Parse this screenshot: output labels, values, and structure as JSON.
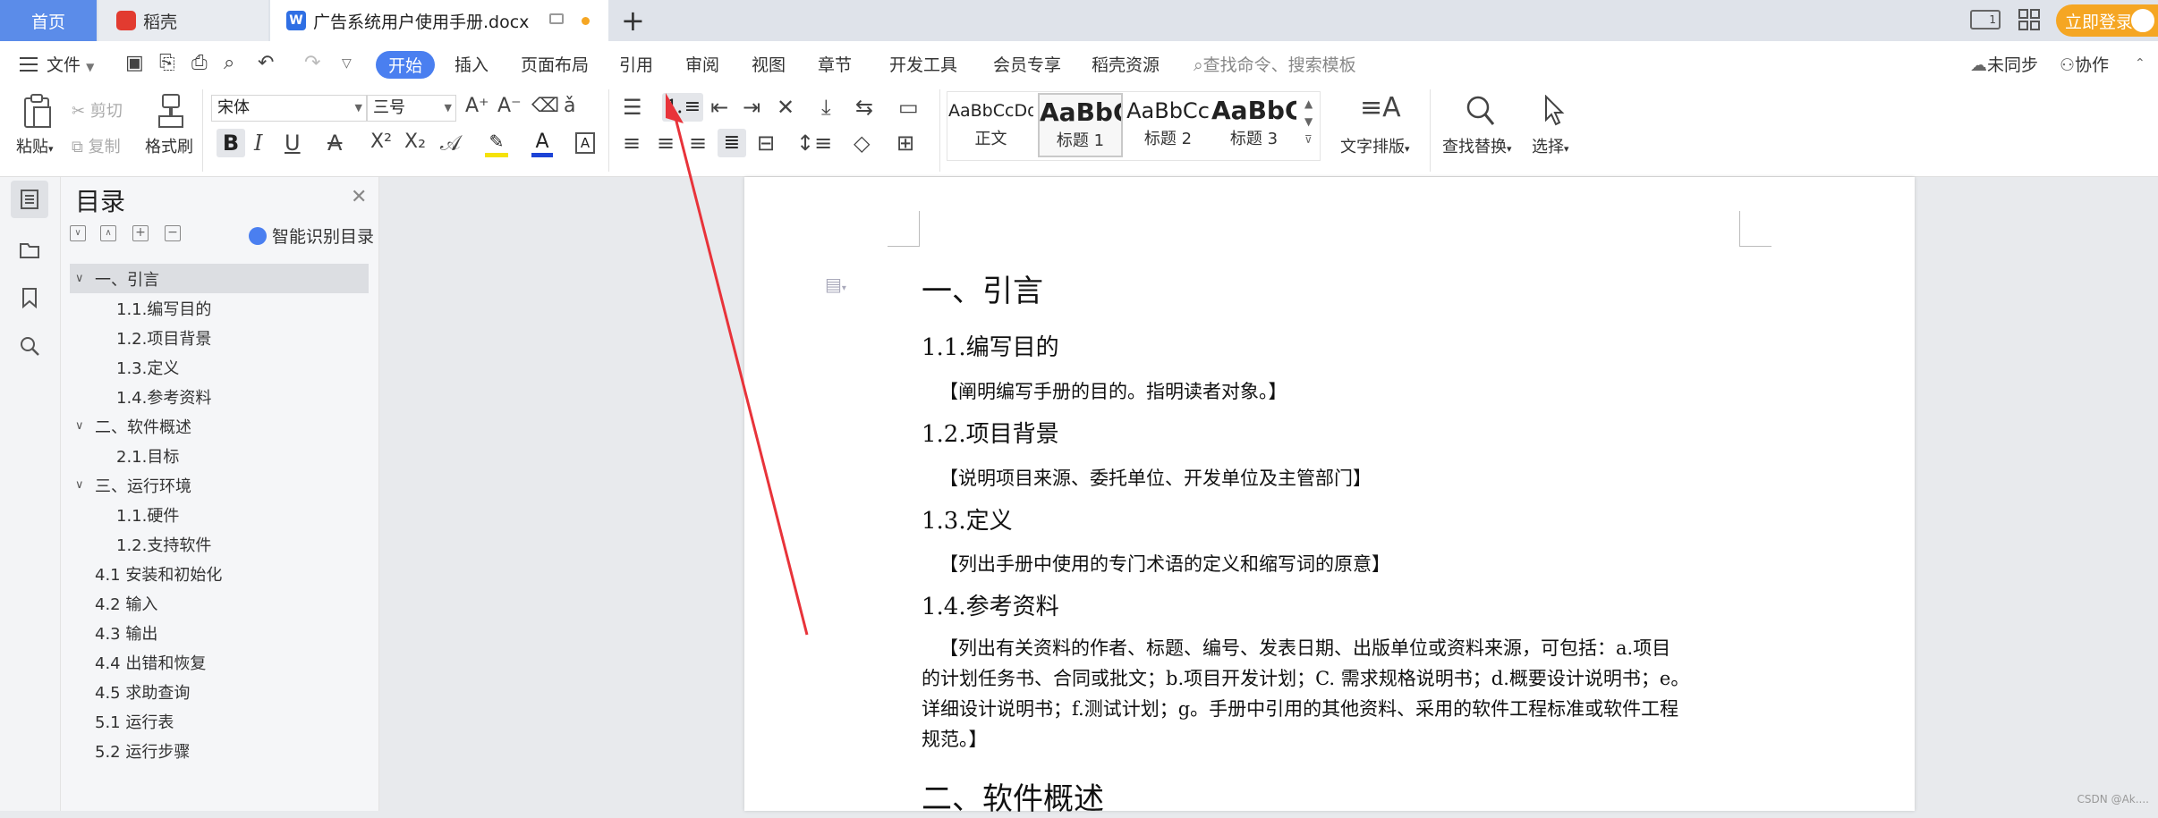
{
  "tabs": {
    "home": "首页",
    "docer": "稻壳",
    "document": "广告系统用户使用手册.docx"
  },
  "titlebar": {
    "login": "立即登录"
  },
  "menu": {
    "file": "文件",
    "items": [
      "开始",
      "插入",
      "页面布局",
      "引用",
      "审阅",
      "视图",
      "章节",
      "开发工具",
      "会员专享",
      "稻壳资源"
    ],
    "search_placeholder": "查找命令、搜索模板",
    "unsync": "未同步",
    "collab": "协作"
  },
  "toolbar": {
    "paste": "粘贴",
    "cut": "剪切",
    "copy": "复制",
    "format_painter": "格式刷",
    "font_name": "宋体",
    "font_size": "三号",
    "styles": [
      {
        "sample": "AaBbCcDd",
        "name": "正文"
      },
      {
        "sample": "AaBbC",
        "name": "标题 1"
      },
      {
        "sample": "AaBbCc",
        "name": "标题 2"
      },
      {
        "sample": "AaBbC",
        "name": "标题 3"
      }
    ],
    "text_layout": "文字排版",
    "find_replace": "查找替换",
    "select": "选择"
  },
  "nav": {
    "title": "目录",
    "smart_toc": "智能识别目录",
    "items": [
      {
        "label": "一、引言",
        "level": 1,
        "expanded": true,
        "selected": true
      },
      {
        "label": "1.1.编写目的",
        "level": 2
      },
      {
        "label": "1.2.项目背景",
        "level": 2
      },
      {
        "label": "1.3.定义",
        "level": 2
      },
      {
        "label": "1.4.参考资料",
        "level": 2
      },
      {
        "label": "二、软件概述",
        "level": 1,
        "expanded": true
      },
      {
        "label": "2.1.目标",
        "level": 2
      },
      {
        "label": "三、运行环境",
        "level": 1,
        "expanded": true
      },
      {
        "label": "1.1.硬件",
        "level": 2
      },
      {
        "label": "1.2.支持软件",
        "level": 2
      },
      {
        "label": "4.1 安装和初始化",
        "level": 1
      },
      {
        "label": "4.2 输入",
        "level": 1
      },
      {
        "label": "4.3 输出",
        "level": 1
      },
      {
        "label": "4.4 出错和恢复",
        "level": 1
      },
      {
        "label": "4.5 求助查询",
        "level": 1
      },
      {
        "label": "5.1 运行表",
        "level": 1
      },
      {
        "label": "5.2 运行步骤",
        "level": 1
      }
    ]
  },
  "document": {
    "h1_intro": "一、引言",
    "h2_purpose": "1.1.编写目的",
    "p_purpose": "【阐明编写手册的目的。指明读者对象。】",
    "h2_background": "1.2.项目背景",
    "p_background": "【说明项目来源、委托单位、开发单位及主管部门】",
    "h2_definition": "1.3.定义",
    "p_definition": "【列出手册中使用的专门术语的定义和缩写词的原意】",
    "h2_references": "1.4.参考资料",
    "p_references_lines": [
      "【列出有关资料的作者、标题、编号、发表日期、出版单位或资料来源，可包括：a.项目",
      "的计划任务书、合同或批文；b.项目开发计划；C. 需求规格说明书；d.概要设计说明书；e。",
      "详细设计说明书；f.测试计划；g。手册中引用的其他资料、采用的软件工程标准或软件工程",
      "规范。】"
    ],
    "h1_overview": "二、软件概述"
  },
  "watermark": "CSDN @Ak....",
  "colors": {
    "accent": "#4a7ff0",
    "home_tab": "#5b8ce9",
    "login": "#f5a623",
    "arrow": "#e8333a"
  }
}
